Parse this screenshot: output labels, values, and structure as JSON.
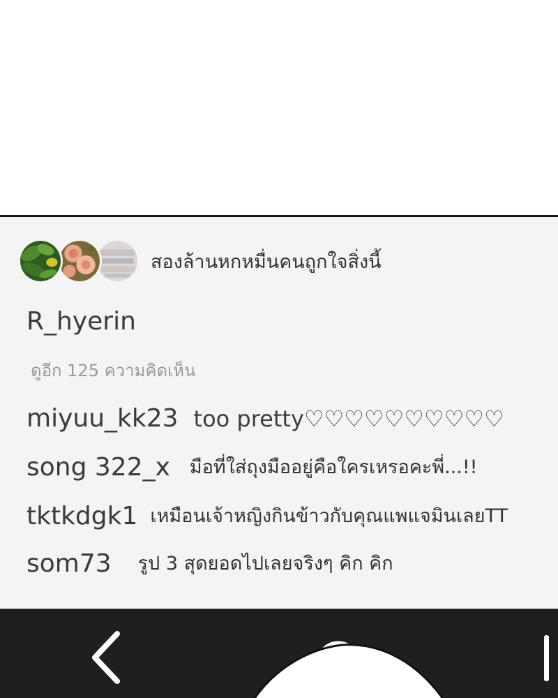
{
  "likes": {
    "text": "สองล้านหกหมื่นคนถูกใจสิ่งนี้",
    "avatars": [
      "leaf-avatar",
      "roses-avatar",
      "pale-sketch-avatar"
    ]
  },
  "post": {
    "username": "R_hyerin",
    "more_comments": "ดูอีก 125 ความคิดเห็น"
  },
  "comments": [
    {
      "author": "miyuu_kk23",
      "text": "too pretty♡♡♡♡♡♡♡♡♡♡"
    },
    {
      "author": "song 322_x",
      "text": "มือที่ใส่ถุงมืออยู่คือใครเหรอคะพี่...!!"
    },
    {
      "author": "tktkdgk1",
      "text": "เหมือนเจ้าหญิงกินข้าวกับคุณแพแจมินเลยTT"
    },
    {
      "author": "som73",
      "text": "รูป 3 สุดยอดไปเลยจริงๆ คิก คิก"
    }
  ],
  "navbar": {
    "icons": [
      "back-chevron-icon",
      "home-circle-icon",
      "recents-bar-icon"
    ]
  },
  "colors": {
    "panel_bg": "#f4f4f4",
    "navbar_bg": "#1f1f1f",
    "text_primary": "#333333",
    "text_muted": "#9a9a9a"
  }
}
